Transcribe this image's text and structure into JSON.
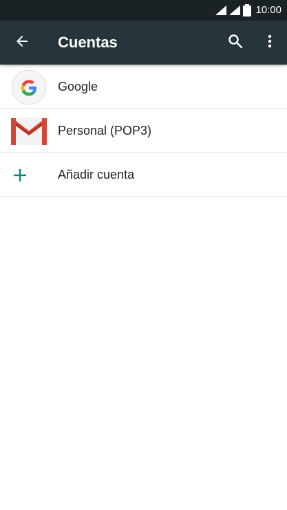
{
  "status_bar": {
    "time": "10:00",
    "wifi_icon": "wifi-signal-icon",
    "cell_icon": "cell-signal-icon",
    "battery_icon": "battery-icon"
  },
  "app_bar": {
    "title": "Cuentas",
    "back_icon": "arrow-back-icon",
    "search_icon": "search-icon",
    "menu_icon": "more-vert-icon",
    "background": "#27353b"
  },
  "accounts": [
    {
      "label": "Google",
      "icon": "google-icon"
    },
    {
      "label": "Personal (POP3)",
      "icon": "gmail-icon"
    }
  ],
  "add_account": {
    "label": "Añadir cuenta",
    "icon": "plus-icon",
    "accent": "#00897b"
  }
}
